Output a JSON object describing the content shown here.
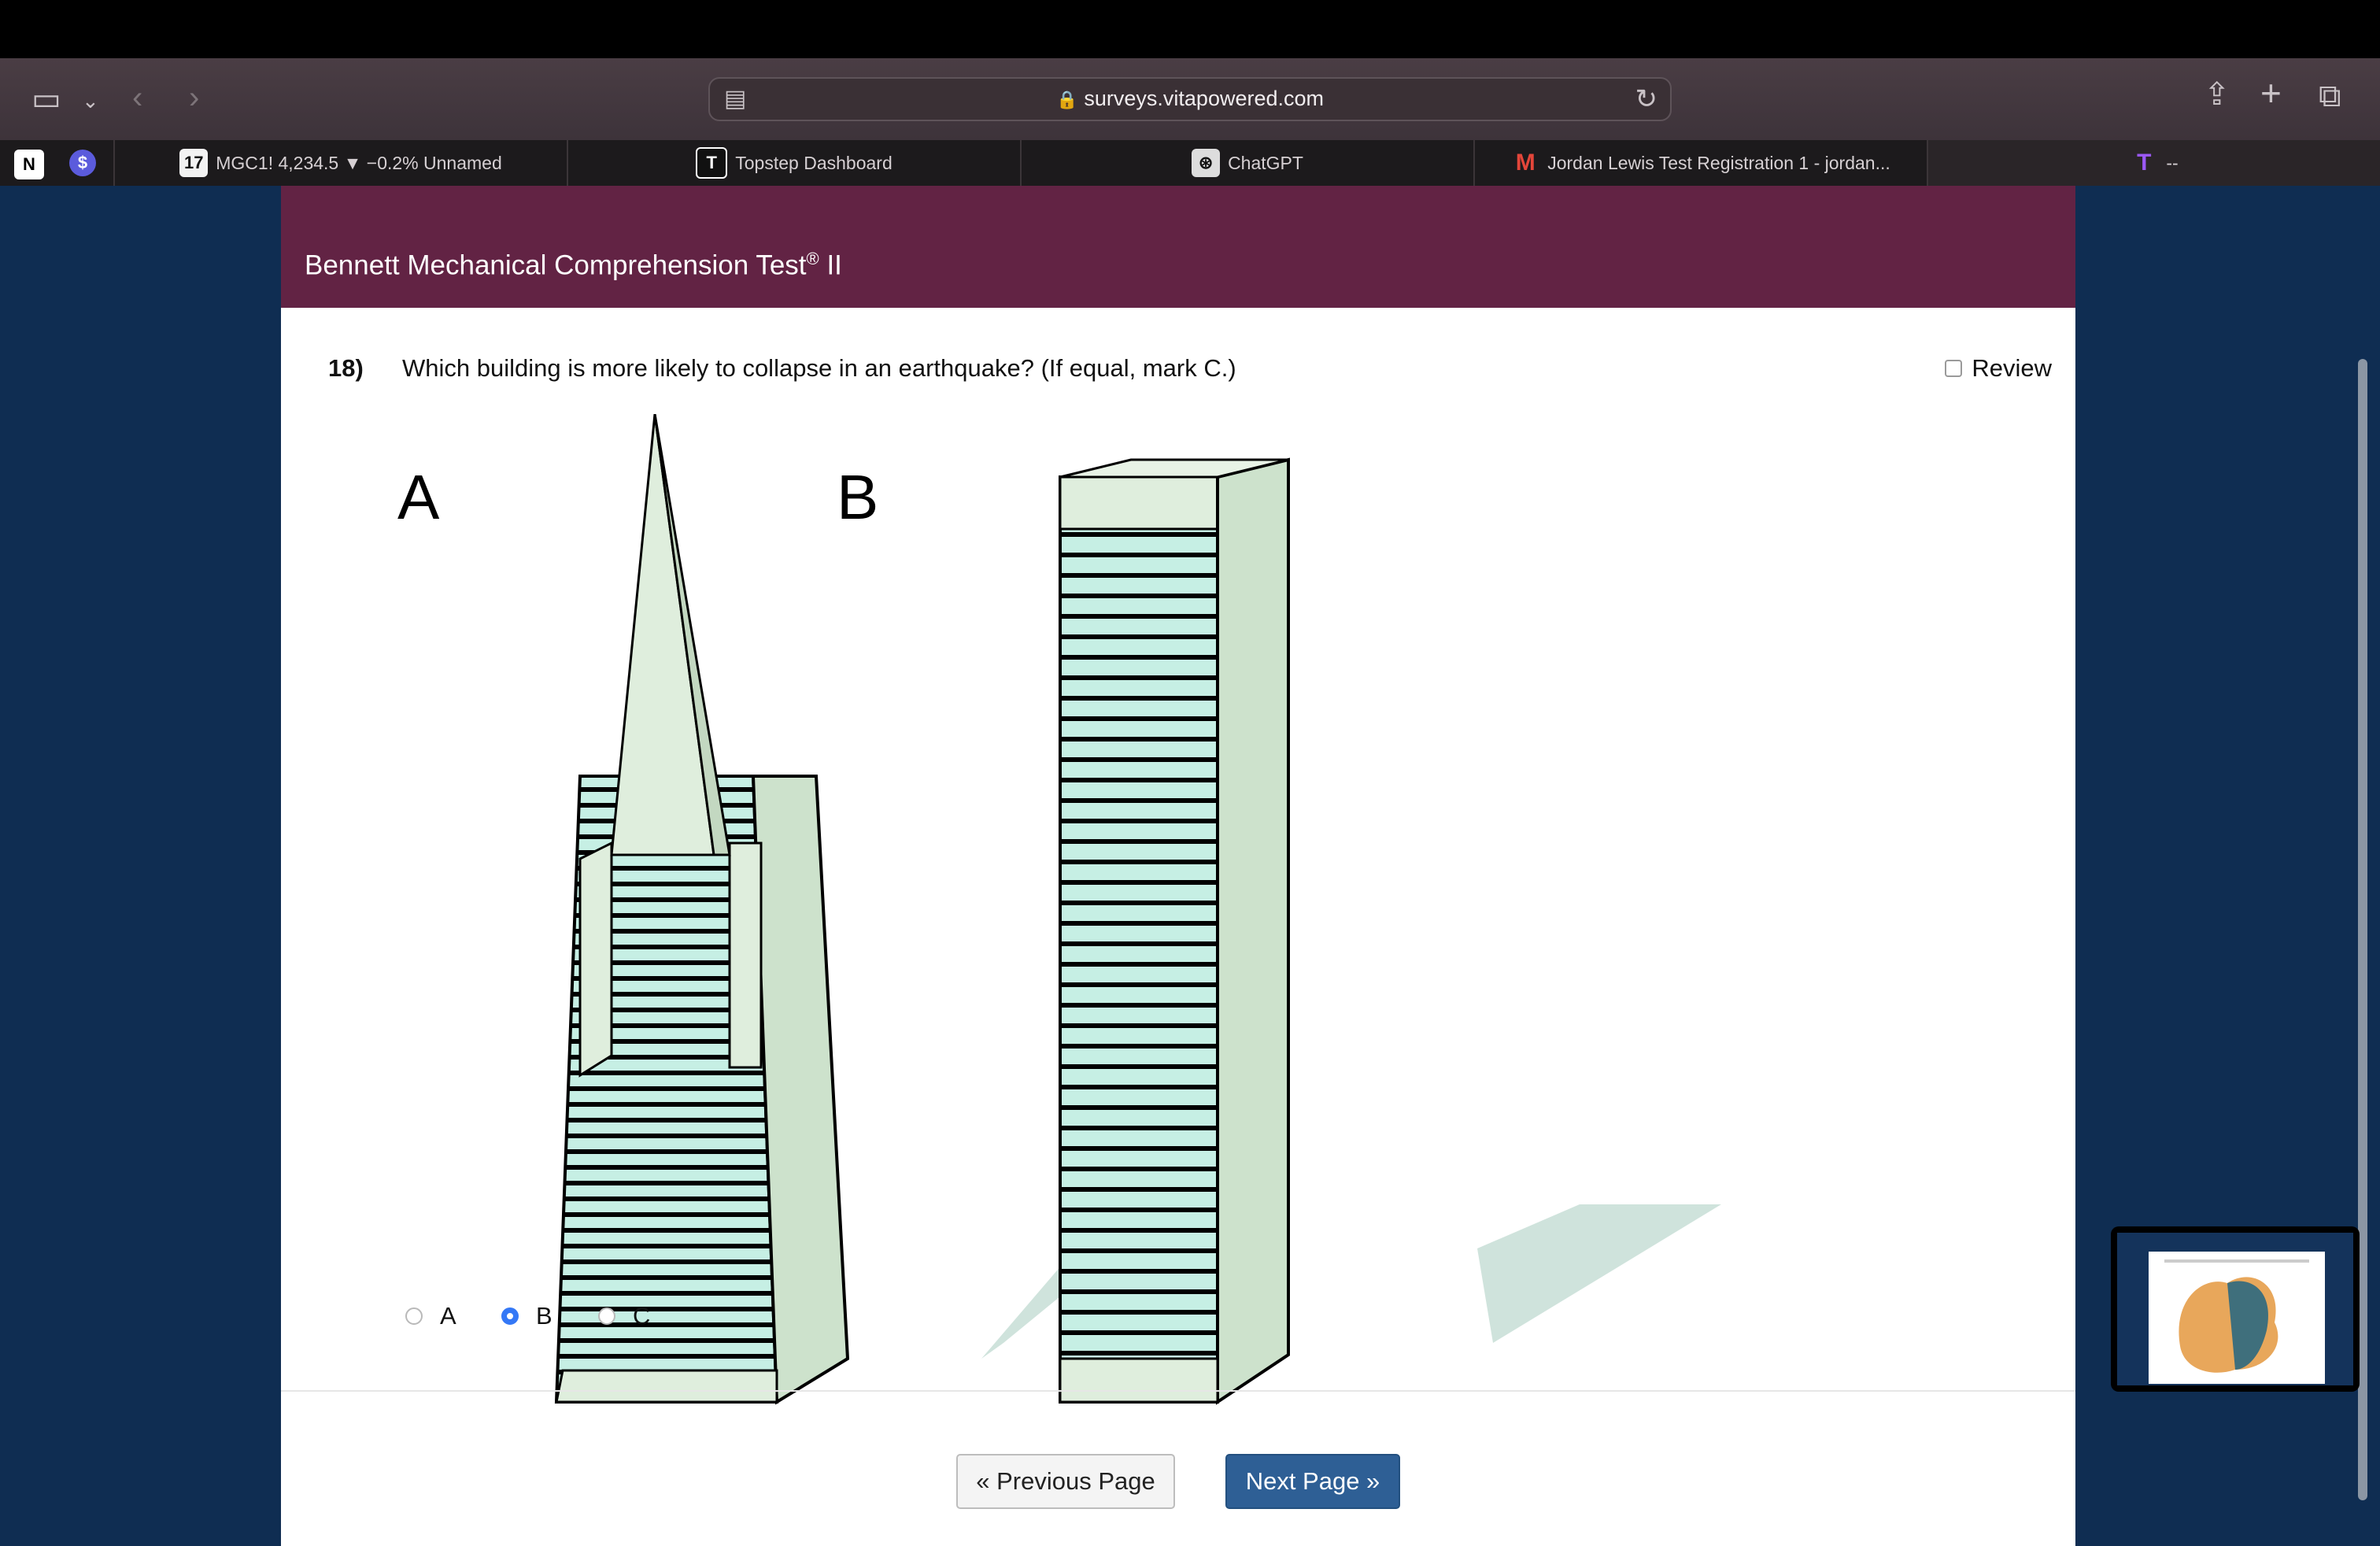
{
  "browser": {
    "url": "surveys.vitapowered.com",
    "tabs": [
      {
        "label": "MGC1! 4,234.5 ▼ −0.2% Unnamed",
        "icon": "tradingview-icon"
      },
      {
        "label": "Topstep Dashboard",
        "icon": "topstep-icon"
      },
      {
        "label": "ChatGPT",
        "icon": "chatgpt-icon"
      },
      {
        "label": "Jordan Lewis Test Registration 1 - jordan...",
        "icon": "gmail-icon"
      },
      {
        "label": "--",
        "icon": "t-icon",
        "active": true
      }
    ]
  },
  "survey": {
    "title": "Bennett Mechanical Comprehension Test",
    "title_mark": "®",
    "title_suffix": " II",
    "question_number": "18)",
    "question_text": "Which building is more likely to collapse in an earthquake? (If equal, mark C.)",
    "review_label": "Review",
    "figure_labels": {
      "a": "A",
      "b": "B"
    },
    "options": [
      {
        "label": "A",
        "selected": false
      },
      {
        "label": "B",
        "selected": true
      },
      {
        "label": "C",
        "selected": false
      }
    ],
    "prev_label": "« Previous Page",
    "next_label": "Next Page »"
  },
  "colors": {
    "banner": "#622344",
    "page_bg": "#0f2d52",
    "next_button": "#2e5f95",
    "radio_selected": "#3478f6"
  }
}
